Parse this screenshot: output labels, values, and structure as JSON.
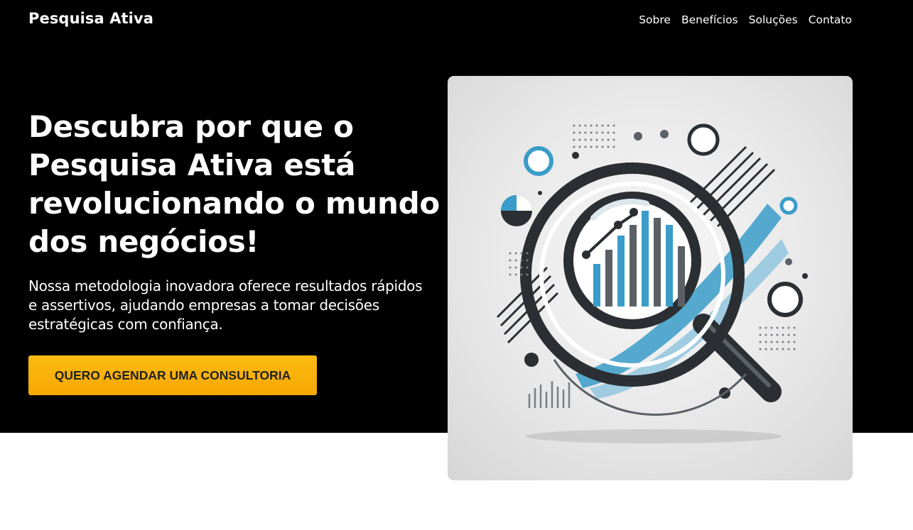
{
  "header": {
    "brand": "Pesquisa Ativa",
    "nav": [
      {
        "label": "Sobre"
      },
      {
        "label": "Benefícios"
      },
      {
        "label": "Soluções"
      },
      {
        "label": "Contato"
      }
    ]
  },
  "hero": {
    "headline": "Descubra por que o Pesquisa Ativa está revolucionando o mundo dos negócios!",
    "subtext": "Nossa metodologia inovadora oferece resultados rápidos e assertivos, ajudando empresas a tomar decisões estratégicas com confiança.",
    "cta_label": "QUERO AGENDAR UMA CONSULTORIA",
    "image_icon": "magnifier-chart-illustration"
  },
  "colors": {
    "hero_bg": "#000000",
    "cta_bg": "#f9b208",
    "accent_blue": "#3a9cc8",
    "dark_gray": "#2b2f33"
  }
}
